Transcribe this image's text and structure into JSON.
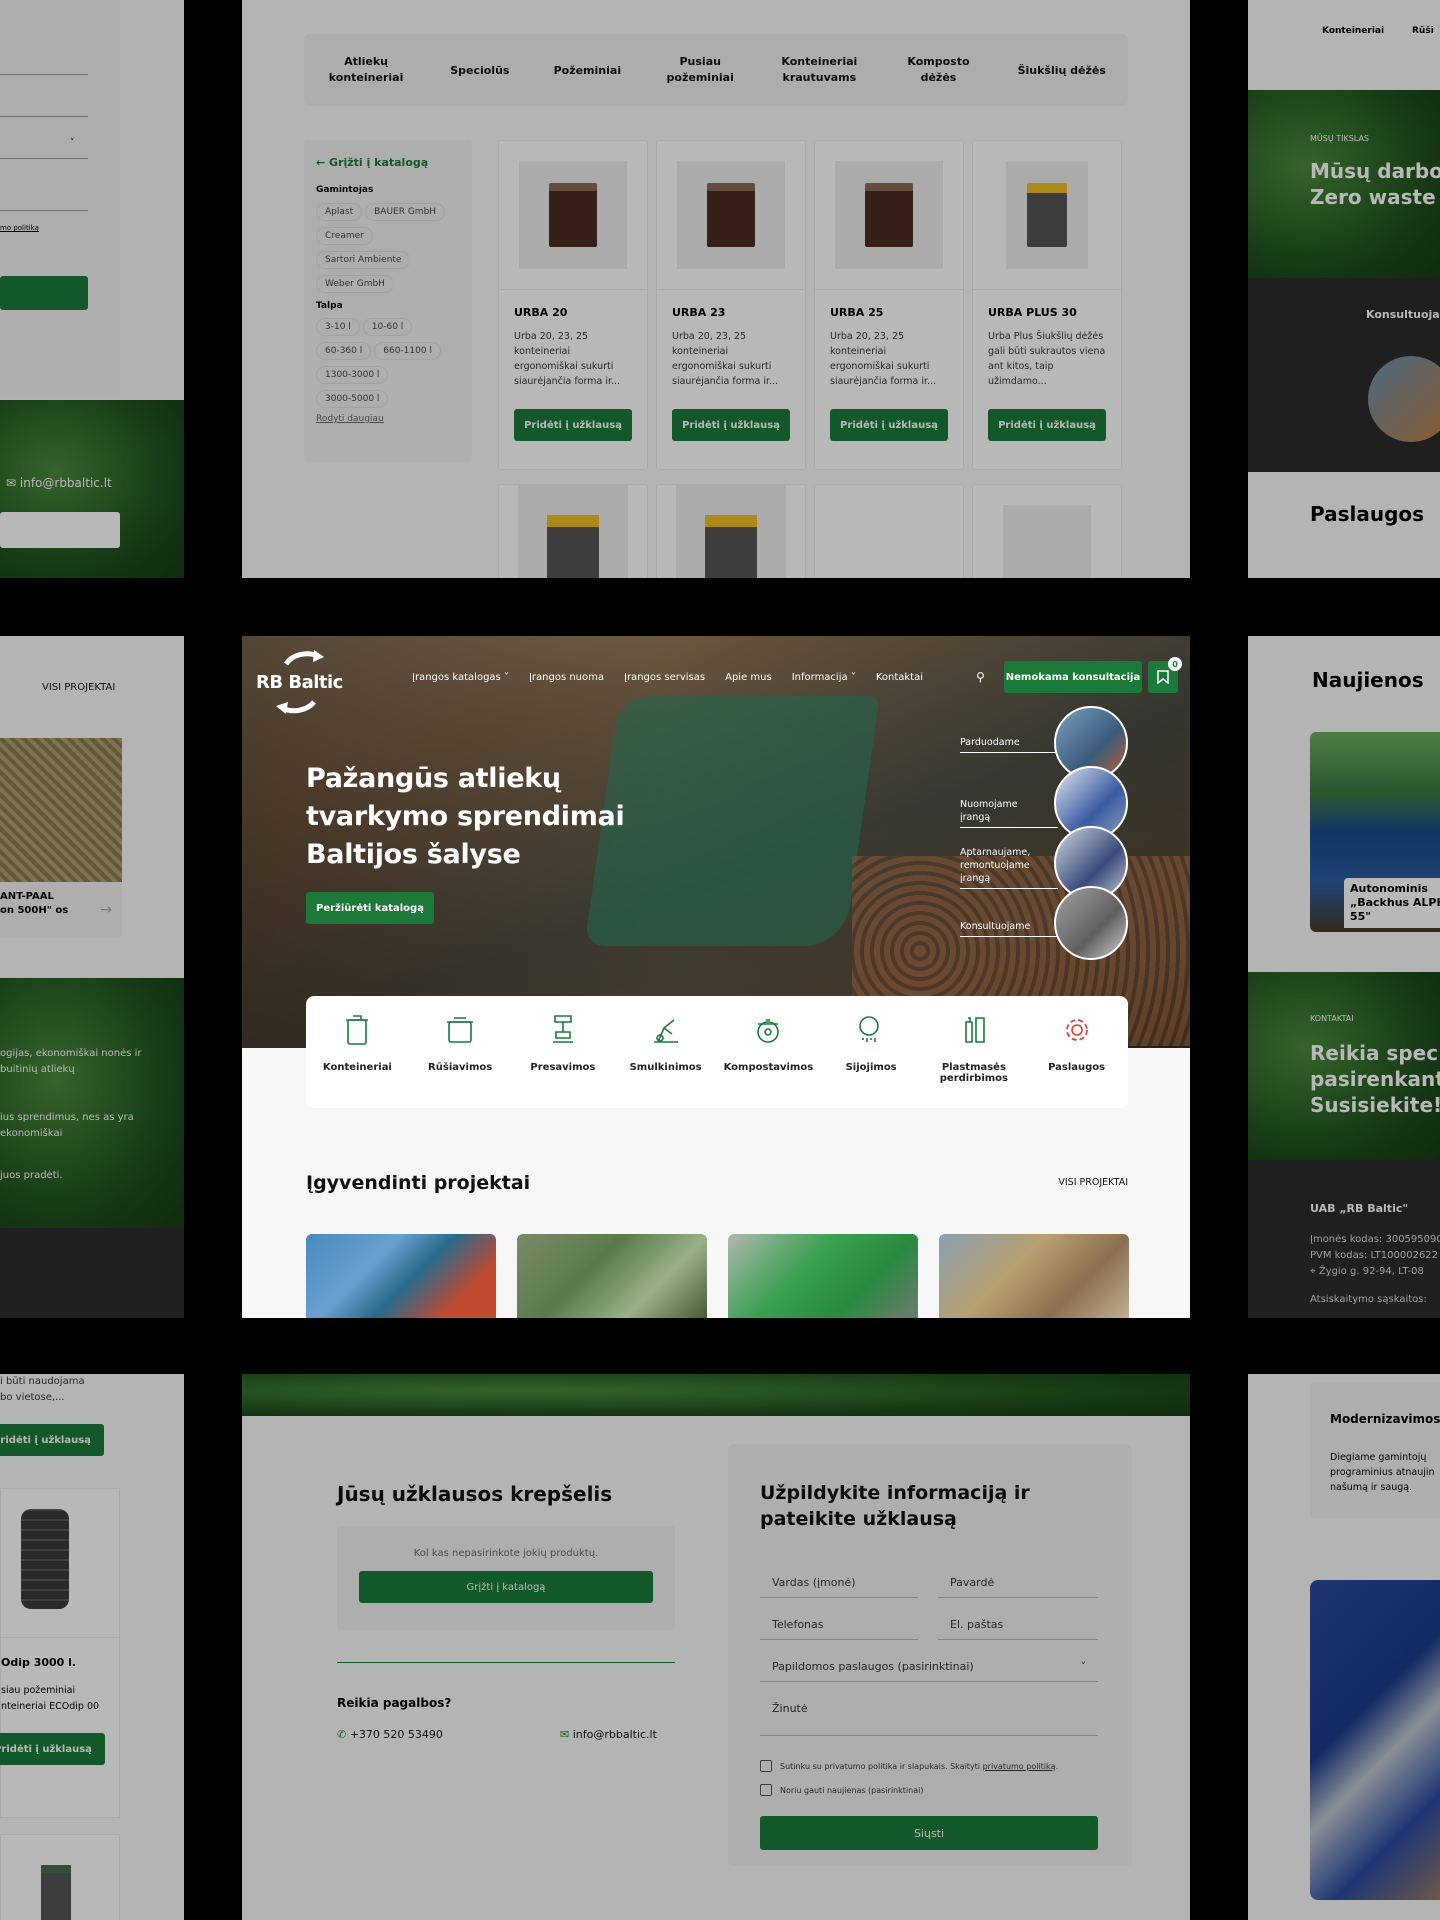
{
  "header": {
    "logo_text": "RB Baltic",
    "nav": [
      "Įrangos katalogas",
      "Įrangos nuoma",
      "Įrangos servisas",
      "Apie mus",
      "Informacija",
      "Kontaktai"
    ],
    "cta": "Nemokama konsultacija",
    "cart_count": "0"
  },
  "hero": {
    "title": "Pažangūs atliekų tvarkymo sprendimai Baltijos šalyse",
    "button": "Peržiūrėti katalogą",
    "services": [
      "Parduodame",
      "Nuomojame įrangą",
      "Aptarnaujame, remontuojame įrangą",
      "Konsultuojame"
    ]
  },
  "categories": [
    "Konteineriai",
    "Rūšiavimos",
    "Presavimos",
    "Smulkinimos",
    "Kompostavimos",
    "Sijojimos",
    "Plastmasės perdirbimos",
    "Paslaugos"
  ],
  "projects": {
    "title": "Įgyvendinti projektai",
    "all": "VISI PROJEKTAI"
  },
  "catalog": {
    "tabs": [
      "Atliekų konteineriai",
      "Speciolūs",
      "Požeminiai",
      "Pusiau požeminiai",
      "Konteineriai krautuvams",
      "Komposto dėžės",
      "Šiukšlių dėžės"
    ],
    "back": "Grįžti į katalogą",
    "maker_title": "Gamintojas",
    "makers": [
      "Aplast",
      "BAUER GmbH",
      "Creamer",
      "Sartori Ambiente",
      "Weber GmbH"
    ],
    "size_title": "Talpa",
    "sizes": [
      "3-10 l",
      "10-60 l",
      "60-360 l",
      "660-1100 l",
      "1300-3000 l",
      "3000-5000 l"
    ],
    "more": "Rodyti daugiau",
    "products": [
      {
        "name": "URBA 20",
        "desc": "Urba 20, 23, 25 konteineriai ergonomiškai sukurti siaurėjančia forma ir..."
      },
      {
        "name": "URBA 23",
        "desc": "Urba 20, 23, 25 konteineriai ergonomiškai sukurti siaurėjančia forma ir..."
      },
      {
        "name": "URBA 25",
        "desc": "Urba 20, 23, 25 konteineriai ergonomiškai sukurti siaurėjančia forma ir..."
      },
      {
        "name": "URBA PLUS 30",
        "desc": "Urba Plus Šiukšlių dėžės gali būti sukrautos viena ant kitos, taip užimdamo..."
      }
    ],
    "add": "Pridėti į užklausą"
  },
  "cart": {
    "title": "Jūsų užklausos krepšelis",
    "empty": "Kol kas nepasirinkote jokių produktų.",
    "back": "Grįžti į katalogą",
    "help": "Reikia pagalbos?",
    "phone": "+370 520 53490",
    "email": "info@rbbaltic.lt"
  },
  "form": {
    "title": "Užpildykite informaciją ir pateikite užklausą",
    "name": "Vardas (įmonė)",
    "surname": "Pavardė",
    "phone": "Telefonas",
    "email": "El. paštas",
    "services": "Papildomos paslaugos (pasirinktinai)",
    "message": "Žinutė",
    "agree": "Sutinku su privatumo politika ir slapukais. Skaityti",
    "agree_link": "privatumo politiką",
    "news": "Noriu gauti naujienas (pasirinktinai)",
    "submit": "Siųsti"
  },
  "left": {
    "policy": "mo politiką",
    "email": "info@rbbaltic.lt",
    "all": "VISI PROJEKTAI",
    "proj_title": "ANT-PAAL on 500H\" os",
    "p1": "ogijas, ekonomiškai nonės ir buitinių atliekų",
    "p2": "ius sprendimus, nes as yra ekonomiškai",
    "p3": "juos pradėti.",
    "desc1": "i būti naudojama bo vietose,...",
    "add": "Pridėti į užklausą",
    "prod": "Odip 3000 l.",
    "desc2": "siau požeminiai nteineriai ECOdip 00"
  },
  "right": {
    "tab1": "Konteineriai",
    "tab2": "Rūši",
    "goal_small": "MŪSŲ TIKSLAS",
    "goal": "Mūsų darbo Zero waste",
    "consult": "Konsultuoja",
    "services": "Paslaugos",
    "news": "Naujienos",
    "news_card": "Autonominis „Backhus ALPH 55\"",
    "contacts_small": "KONTAKTAI",
    "contacts": "Reikia spec pasirenkant Susisiekite!",
    "company": "UAB „RB Baltic\"",
    "code": "Įmonės kodas: 300595090",
    "vat": "PVM kodas: LT100002622",
    "addr": "Žygio g. 92-94, LT-08",
    "bank": "Atsiskaitymo sąskaitos:",
    "modern": "Modernizavimos",
    "modern_text": "Diegiame gamintojų programinius atnaujin našumą ir saugą."
  },
  "colors": {
    "brand_green": "#1b7a3a",
    "dark": "#2b2b2b"
  }
}
